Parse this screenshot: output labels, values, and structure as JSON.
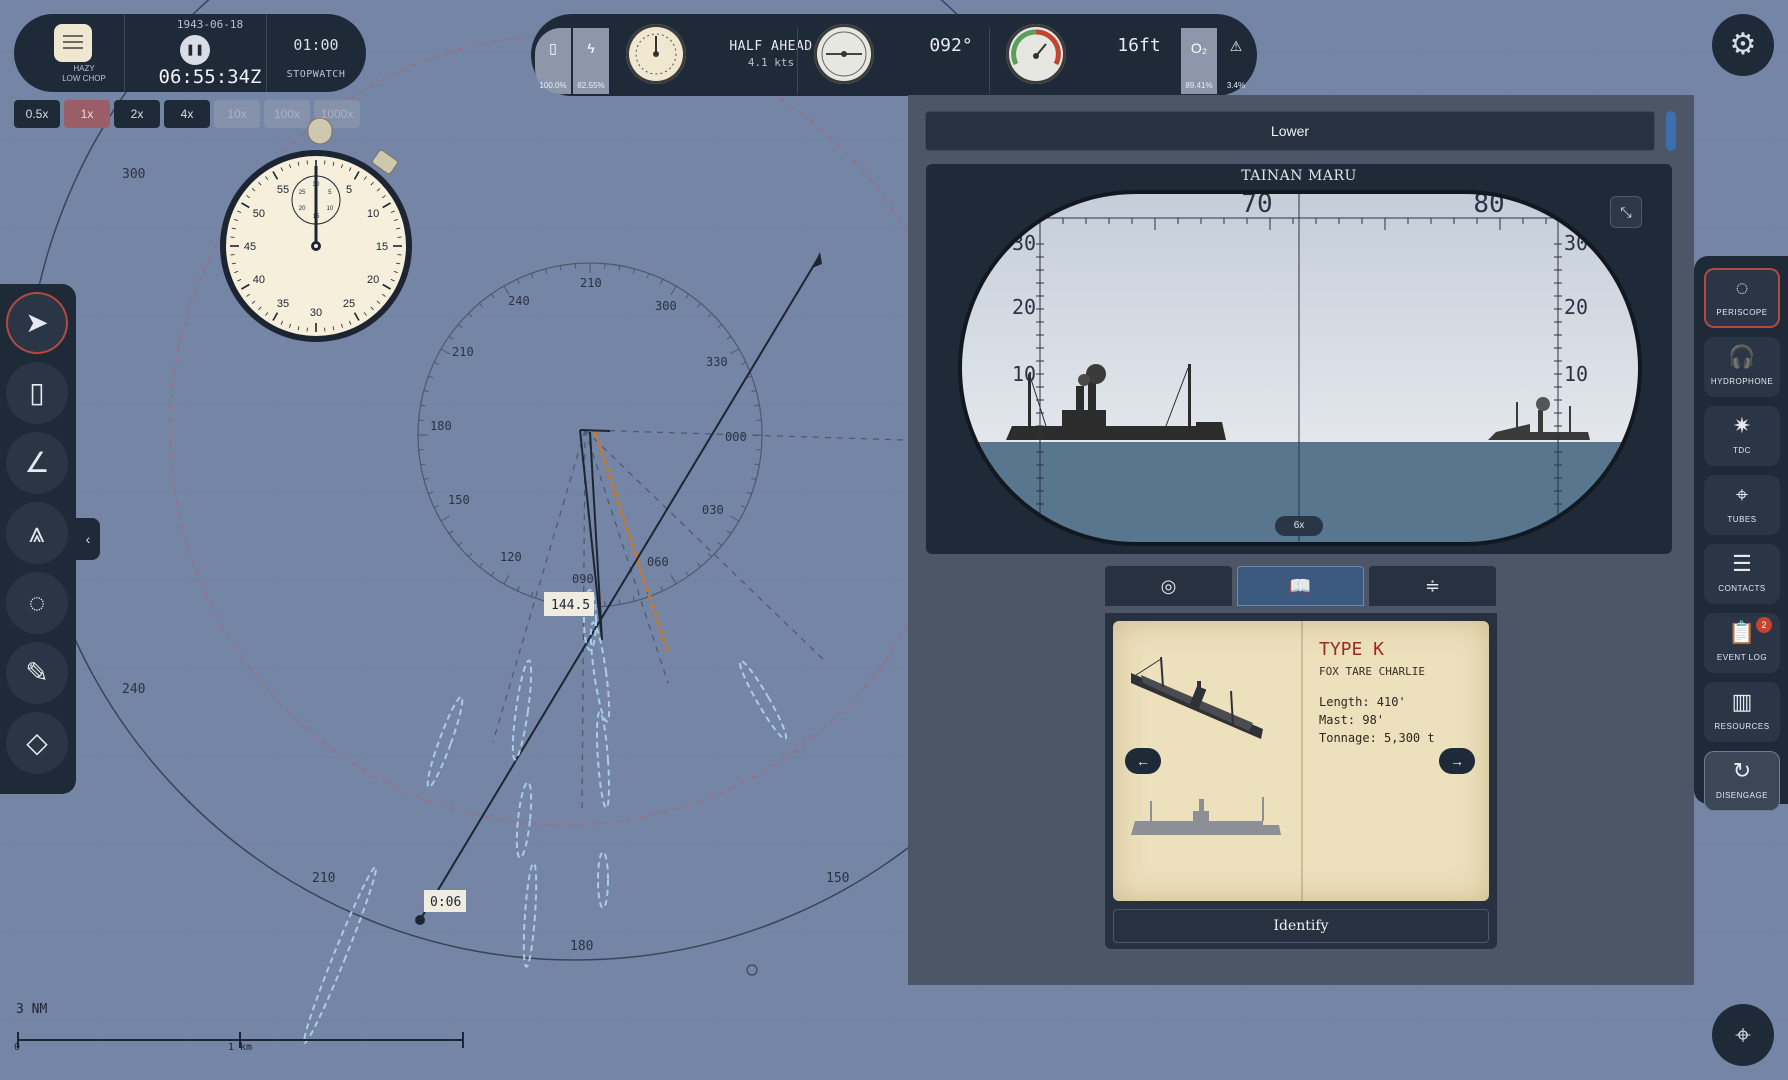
{
  "clock": {
    "weather_line1": "HAZY",
    "weather_line2": "LOW CHOP",
    "date": "1943-06-18",
    "pause_icon": "❚❚",
    "time": "06:55:34Z",
    "stopwatch_time": "01:00",
    "stopwatch_label": "STOPWATCH"
  },
  "time_compression": {
    "options": [
      "0.5x",
      "1x",
      "2x",
      "4x",
      "10x",
      "100x",
      "1000x"
    ],
    "active": "1x",
    "disabled": [
      "10x",
      "100x",
      "1000x"
    ]
  },
  "gauges": {
    "battery_pct": "100.0%",
    "battery_icon": "battery-icon",
    "charge_pct": "82.55%",
    "charge_icon": "lightning-icon",
    "engine_order": "HALF AHEAD",
    "speed": "4.1 kts",
    "heading": "092°",
    "depth": "16ft",
    "oxygen_label": "O₂",
    "oxygen_pct": "89.41%",
    "warning_icon": "⚠",
    "warning_pct": "3.4%"
  },
  "map": {
    "bearing_labels": [
      "210",
      "240",
      "300",
      "330",
      "000",
      "030",
      "060",
      "090",
      "120",
      "150",
      "180"
    ],
    "range_labels": [
      "300",
      "240",
      "210",
      "150",
      "180"
    ],
    "range_tag": "144.5",
    "time_tag": "0:06",
    "scale_title": "3 NM",
    "scale_start": "0",
    "scale_mid": "1 km"
  },
  "left_tools": [
    "pointer-tool",
    "ruler-tool",
    "protractor-tool",
    "compass-tool",
    "circle-tool",
    "pencil-tool",
    "eraser-tool"
  ],
  "periscope_panel": {
    "depth_button": "Lower",
    "target_name": "TAINAN MARU",
    "bearing_ticks": [
      "70",
      "80"
    ],
    "elevation_ticks": [
      "30",
      "20",
      "10"
    ],
    "zoom": "6x",
    "expand_icon": "⤡"
  },
  "id_book": {
    "tabs": [
      "target-icon",
      "book-icon",
      "stadimeter-icon"
    ],
    "active_tab": 1,
    "ship_type": "TYPE K",
    "ship_code": "FOX TARE CHARLIE",
    "length": "Length: 410'",
    "mast": "Mast: 98'",
    "tonnage": "Tonnage: 5,300 t",
    "prev": "←",
    "next": "→",
    "identify_label": "Identify"
  },
  "stations": [
    {
      "label": "PERISCOPE",
      "icon": "◌",
      "active": true
    },
    {
      "label": "HYDROPHONE",
      "icon": "🎧",
      "active": false
    },
    {
      "label": "TDC",
      "icon": "✷",
      "active": false
    },
    {
      "label": "TUBES",
      "icon": "⌖",
      "active": false
    },
    {
      "label": "CONTACTS",
      "icon": "☰",
      "active": false
    },
    {
      "label": "EVENT LOG",
      "icon": "📋",
      "active": false,
      "badge": "2"
    },
    {
      "label": "RESOURCES",
      "icon": "▥",
      "active": false
    },
    {
      "label": "DISENGAGE",
      "icon": "↻",
      "active": false
    }
  ],
  "stopwatch": {
    "outer_numbers": [
      "5",
      "10",
      "15",
      "20",
      "25",
      "30",
      "35",
      "40",
      "45",
      "50",
      "55"
    ],
    "inner_numbers": [
      "5",
      "10",
      "15",
      "20",
      "25",
      "30"
    ]
  },
  "colors": {
    "map_bg": "#7585a5",
    "panel_dark": "#1f2a38",
    "active_accent": "#b5493f",
    "bearing_line_orange": "#c47a2c",
    "wake_blue": "#a9cde6"
  }
}
